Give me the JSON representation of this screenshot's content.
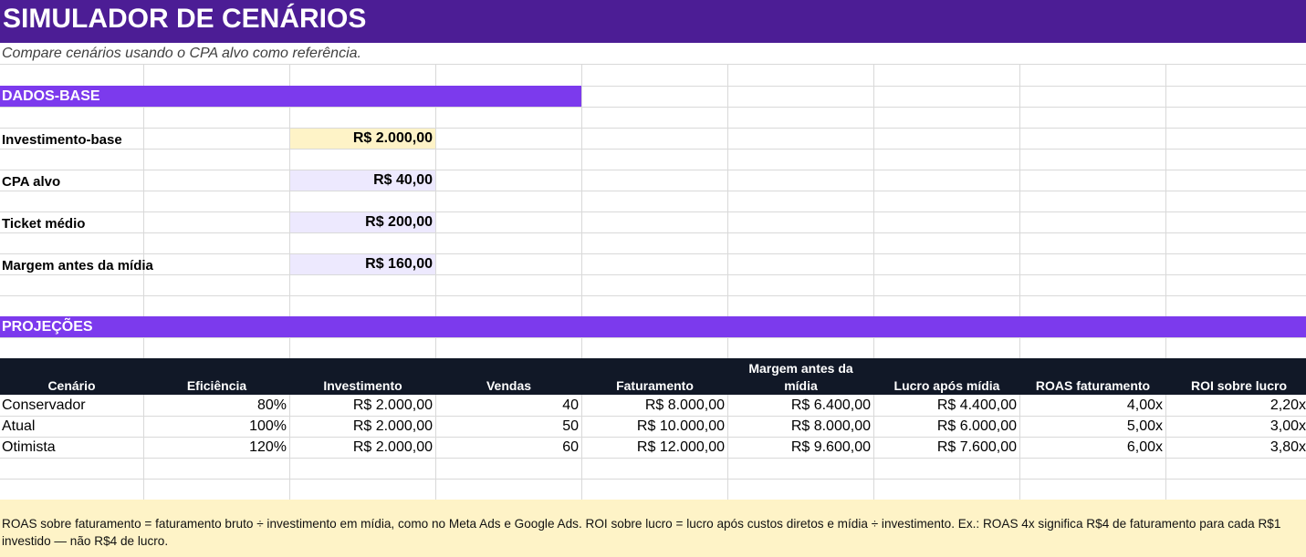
{
  "title": "SIMULADOR DE CENÁRIOS",
  "subtitle": "Compare cenários usando o CPA alvo como referência.",
  "dados_base": {
    "header": "DADOS-BASE",
    "rows": [
      {
        "label": "Investimento-base",
        "value": "R$ 2.000,00"
      },
      {
        "label": "CPA alvo",
        "value": "R$ 40,00"
      },
      {
        "label": "Ticket médio",
        "value": "R$ 200,00"
      },
      {
        "label": "Margem antes da mídia",
        "value": "R$ 160,00"
      }
    ]
  },
  "projecoes": {
    "header": "PROJEÇÕES",
    "columns": [
      "Cenário",
      "Eficiência",
      "Investimento",
      "Vendas",
      "Faturamento",
      "Margem antes da mídia",
      "Lucro após mídia",
      "ROAS faturamento",
      "ROI sobre lucro"
    ],
    "column_lines": {
      "margem": [
        "Margem antes da",
        "mídia"
      ]
    },
    "rows": [
      [
        "Conservador",
        "80%",
        "R$ 2.000,00",
        "40",
        "R$ 8.000,00",
        "R$ 6.400,00",
        "R$ 4.400,00",
        "4,00x",
        "2,20x"
      ],
      [
        "Atual",
        "100%",
        "R$ 2.000,00",
        "50",
        "R$ 10.000,00",
        "R$ 8.000,00",
        "R$ 6.000,00",
        "5,00x",
        "3,00x"
      ],
      [
        "Otimista",
        "120%",
        "R$ 2.000,00",
        "60",
        "R$ 12.000,00",
        "R$ 9.600,00",
        "R$ 7.600,00",
        "6,00x",
        "3,80x"
      ]
    ]
  },
  "note": "ROAS sobre faturamento = faturamento bruto ÷ investimento em mídia, como no Meta Ads e Google Ads. ROI sobre lucro = lucro após custos diretos e mídia ÷ investimento. Ex.: ROAS 4x significa R$4 de faturamento para cada R$1 investido — não R$4 de lucro.",
  "colors": {
    "title_bg": "#4c1d95",
    "section_bg": "#7c3aed",
    "table_header_bg": "#111827",
    "highlight_input": "#fef3c7",
    "highlight_value": "#ede9fe",
    "note_bg": "#fef3c7"
  }
}
